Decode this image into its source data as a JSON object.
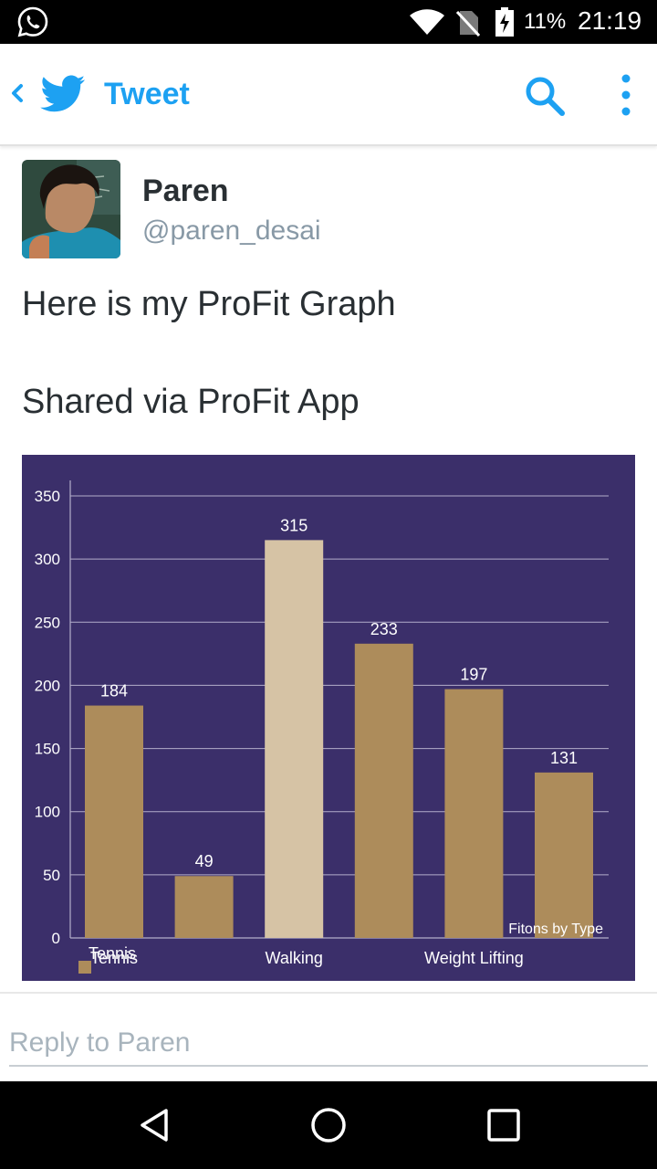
{
  "status_bar": {
    "battery_percent": "11%",
    "time": "21:19"
  },
  "app_bar": {
    "title": "Tweet"
  },
  "tweet": {
    "author_name": "Paren",
    "author_handle": "@paren_desai",
    "text_line1": "Here is my ProFit Graph",
    "text_line2": "Shared via ProFit App"
  },
  "chart_data": {
    "type": "bar",
    "categories": [
      "Tennis",
      "",
      "Walking",
      "",
      "Weight Lifting",
      ""
    ],
    "values": [
      184,
      49,
      315,
      233,
      197,
      131
    ],
    "highlighted_index": 2,
    "ylim": [
      0,
      350
    ],
    "yticks": [
      0,
      50,
      100,
      150,
      200,
      250,
      300,
      350
    ],
    "annotation": "Fitons by Type",
    "legend": "Tennis",
    "grid": true,
    "colors": {
      "background": "#3b2f6a",
      "bar": "#ad8c5b",
      "highlight_bar": "#d6c3a5",
      "gridline": "#b3aecb",
      "text": "#ffffff"
    }
  },
  "reply": {
    "placeholder": "Reply to Paren"
  },
  "colors": {
    "twitter_blue": "#1da1f2"
  }
}
